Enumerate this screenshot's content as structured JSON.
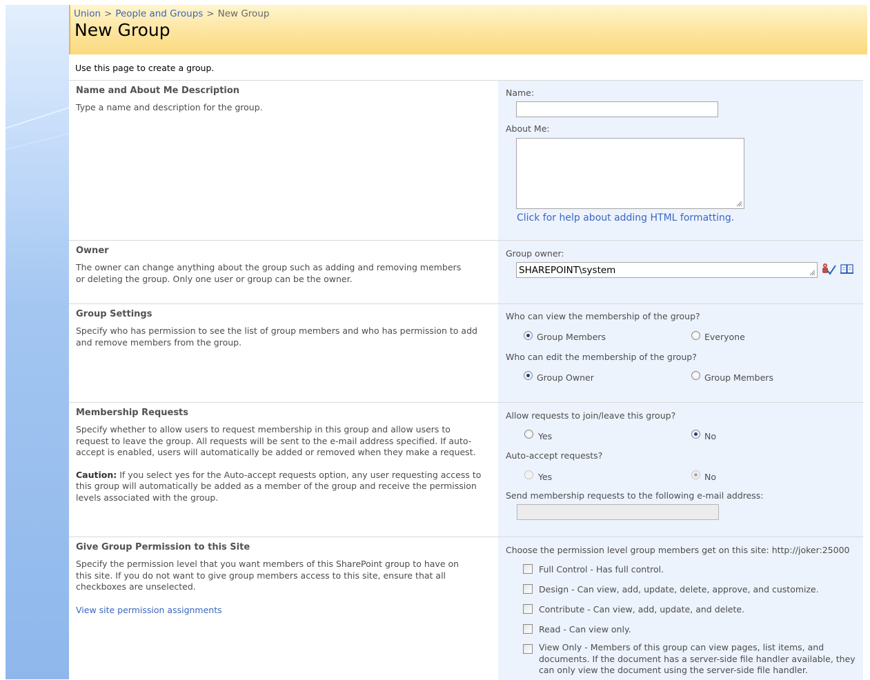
{
  "breadcrumb": {
    "site": "Union",
    "parent": "People and Groups",
    "current": "New Group",
    "separator": ">"
  },
  "page": {
    "title": "New Group",
    "intro": "Use this page to create a group."
  },
  "sections": {
    "name": {
      "title": "Name and About Me Description",
      "description": "Type a name and description for the group.",
      "name_label": "Name:",
      "name_value": "",
      "about_label": "About Me:",
      "about_value": "",
      "help_link": "Click for help about adding HTML formatting."
    },
    "owner": {
      "title": "Owner",
      "description": "The owner can change anything about the group such as adding and removing members or deleting the group. Only one user or group can be the owner.",
      "label": "Group owner:",
      "value": "SHAREPOINT\\system",
      "check_names_icon": "check-names-icon",
      "browse_icon": "address-book-icon"
    },
    "settings": {
      "title": "Group Settings",
      "description": "Specify who has permission to see the list of group members and who has permission to add and remove members from the group.",
      "view_question": "Who can view the membership of the group?",
      "view_options": [
        "Group Members",
        "Everyone"
      ],
      "view_selected": "Group Members",
      "edit_question": "Who can edit the membership of the group?",
      "edit_options": [
        "Group Owner",
        "Group Members"
      ],
      "edit_selected": "Group Owner"
    },
    "requests": {
      "title": "Membership Requests",
      "description": "Specify whether to allow users to request membership in this group and allow users to request to leave the group. All requests will be sent to the e-mail address specified. If auto-accept is enabled, users will automatically be added or removed when they make a request.",
      "caution_label": "Caution:",
      "caution_text": " If you select yes for the Auto-accept requests option, any user requesting access to this group will automatically be added as a member of the group and receive the permission levels associated with the group.",
      "allow_question": "Allow requests to join/leave this group?",
      "allow_options": [
        "Yes",
        "No"
      ],
      "allow_selected": "No",
      "auto_question": "Auto-accept requests?",
      "auto_options": [
        "Yes",
        "No"
      ],
      "auto_selected": "No",
      "email_label": "Send membership requests to the following e-mail address:",
      "email_value": ""
    },
    "permissions": {
      "title": "Give Group Permission to this Site",
      "description": "Specify the permission level that you want members of this SharePoint group to have on this site. If you do not want to give group members access to this site, ensure that all checkboxes are unselected.",
      "view_link": "View site permission assignments",
      "choose_label": "Choose the permission level group members get on this site: http://joker:25000",
      "levels": [
        {
          "label": "Full Control - Has full control.",
          "checked": false
        },
        {
          "label": "Design - Can view, add, update, delete, approve, and customize.",
          "checked": false
        },
        {
          "label": "Contribute - Can view, add, update, and delete.",
          "checked": false
        },
        {
          "label": "Read - Can view only.",
          "checked": false
        },
        {
          "label": "View Only - Members of this group can view pages, list items, and documents. If the document has a server-side file handler available, they can only view the document using the server-side file handler.",
          "checked": false
        }
      ]
    }
  },
  "colors": {
    "link": "#3966bf",
    "title_bar": "#fbd97d",
    "form_panel": "#edf3fd",
    "left_bar": "#a3c6f1"
  }
}
